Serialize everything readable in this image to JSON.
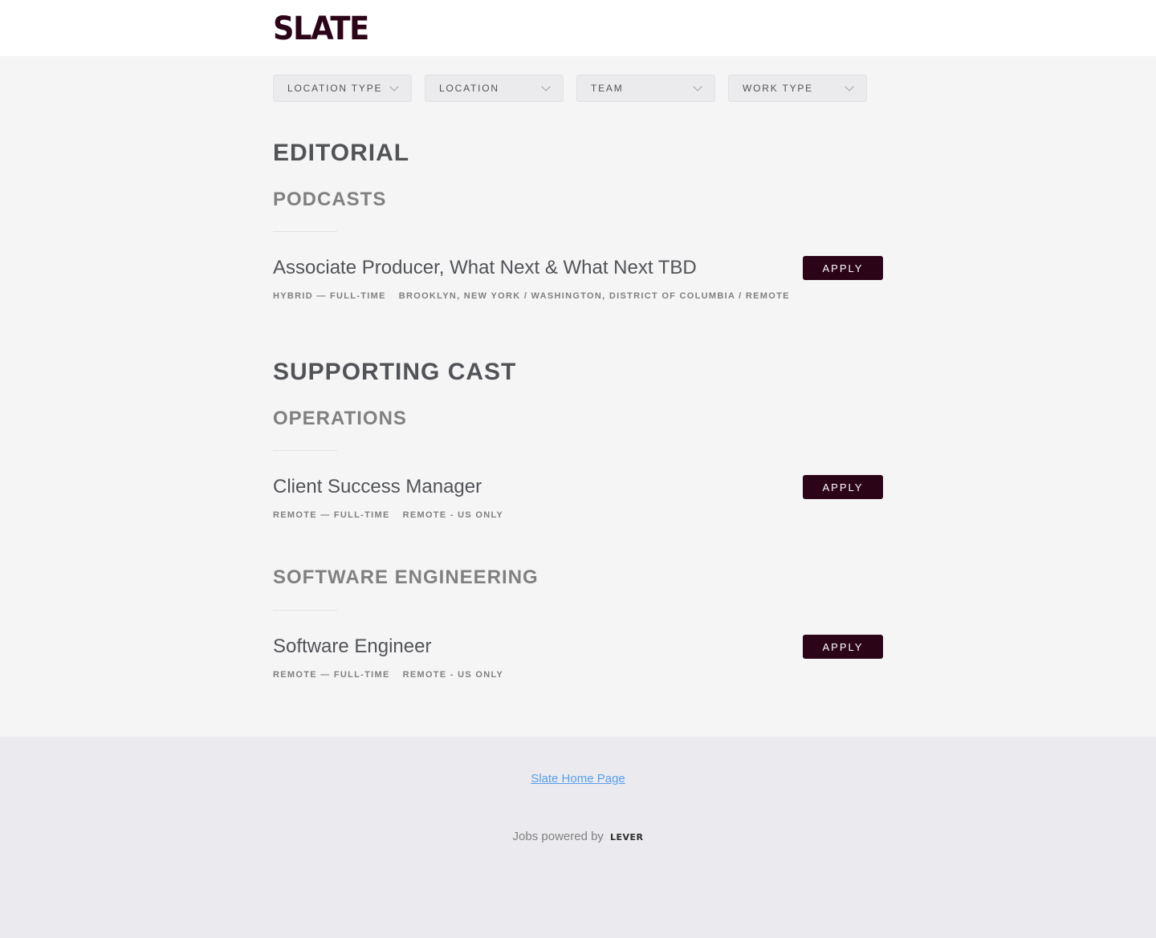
{
  "header": {
    "logo_text": "SLATE"
  },
  "filters": [
    {
      "label": "LOCATION TYPE"
    },
    {
      "label": "LOCATION"
    },
    {
      "label": "TEAM"
    },
    {
      "label": "WORK TYPE"
    }
  ],
  "groups": [
    {
      "title": "EDITORIAL",
      "teams": [
        {
          "title": "PODCASTS",
          "postings": [
            {
              "title": "Associate Producer, What Next & What Next TBD",
              "commitment": "HYBRID — FULL-TIME",
              "location": "BROOKLYN, NEW YORK / WASHINGTON, DISTRICT OF COLUMBIA / REMOTE",
              "apply": "APPLY"
            }
          ]
        }
      ]
    },
    {
      "title": "SUPPORTING CAST",
      "teams": [
        {
          "title": "OPERATIONS",
          "postings": [
            {
              "title": "Client Success Manager",
              "commitment": "REMOTE — FULL-TIME",
              "location": "REMOTE - US ONLY",
              "apply": "APPLY"
            }
          ]
        },
        {
          "title": "SOFTWARE ENGINEERING",
          "postings": [
            {
              "title": "Software Engineer",
              "commitment": "REMOTE — FULL-TIME",
              "location": "REMOTE - US ONLY",
              "apply": "APPLY"
            }
          ]
        }
      ]
    }
  ],
  "footer": {
    "home_link": "Slate Home Page",
    "powered_by": "Jobs powered by",
    "lever_logo": "LEVER"
  },
  "colors": {
    "brand": "#2c0418",
    "link": "#579eee",
    "background": "#f5f5f6",
    "footer_background": "#ebebef"
  }
}
